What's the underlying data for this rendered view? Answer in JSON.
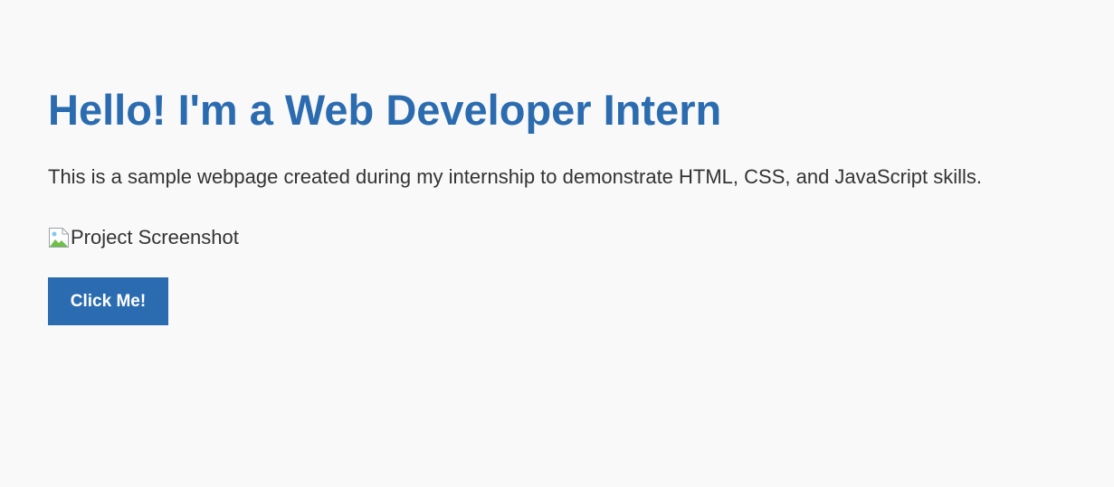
{
  "page": {
    "title": "Hello! I'm a Web Developer Intern",
    "intro": "This is a sample webpage created during my internship to demonstrate HTML, CSS, and JavaScript skills.",
    "image": {
      "alt": "Project Screenshot",
      "icon": "broken-image-icon"
    },
    "button": {
      "label": "Click Me!"
    }
  },
  "colors": {
    "background": "#f9f9f9",
    "accent": "#2b6cb0",
    "text": "#333333",
    "button_text": "#ffffff"
  }
}
